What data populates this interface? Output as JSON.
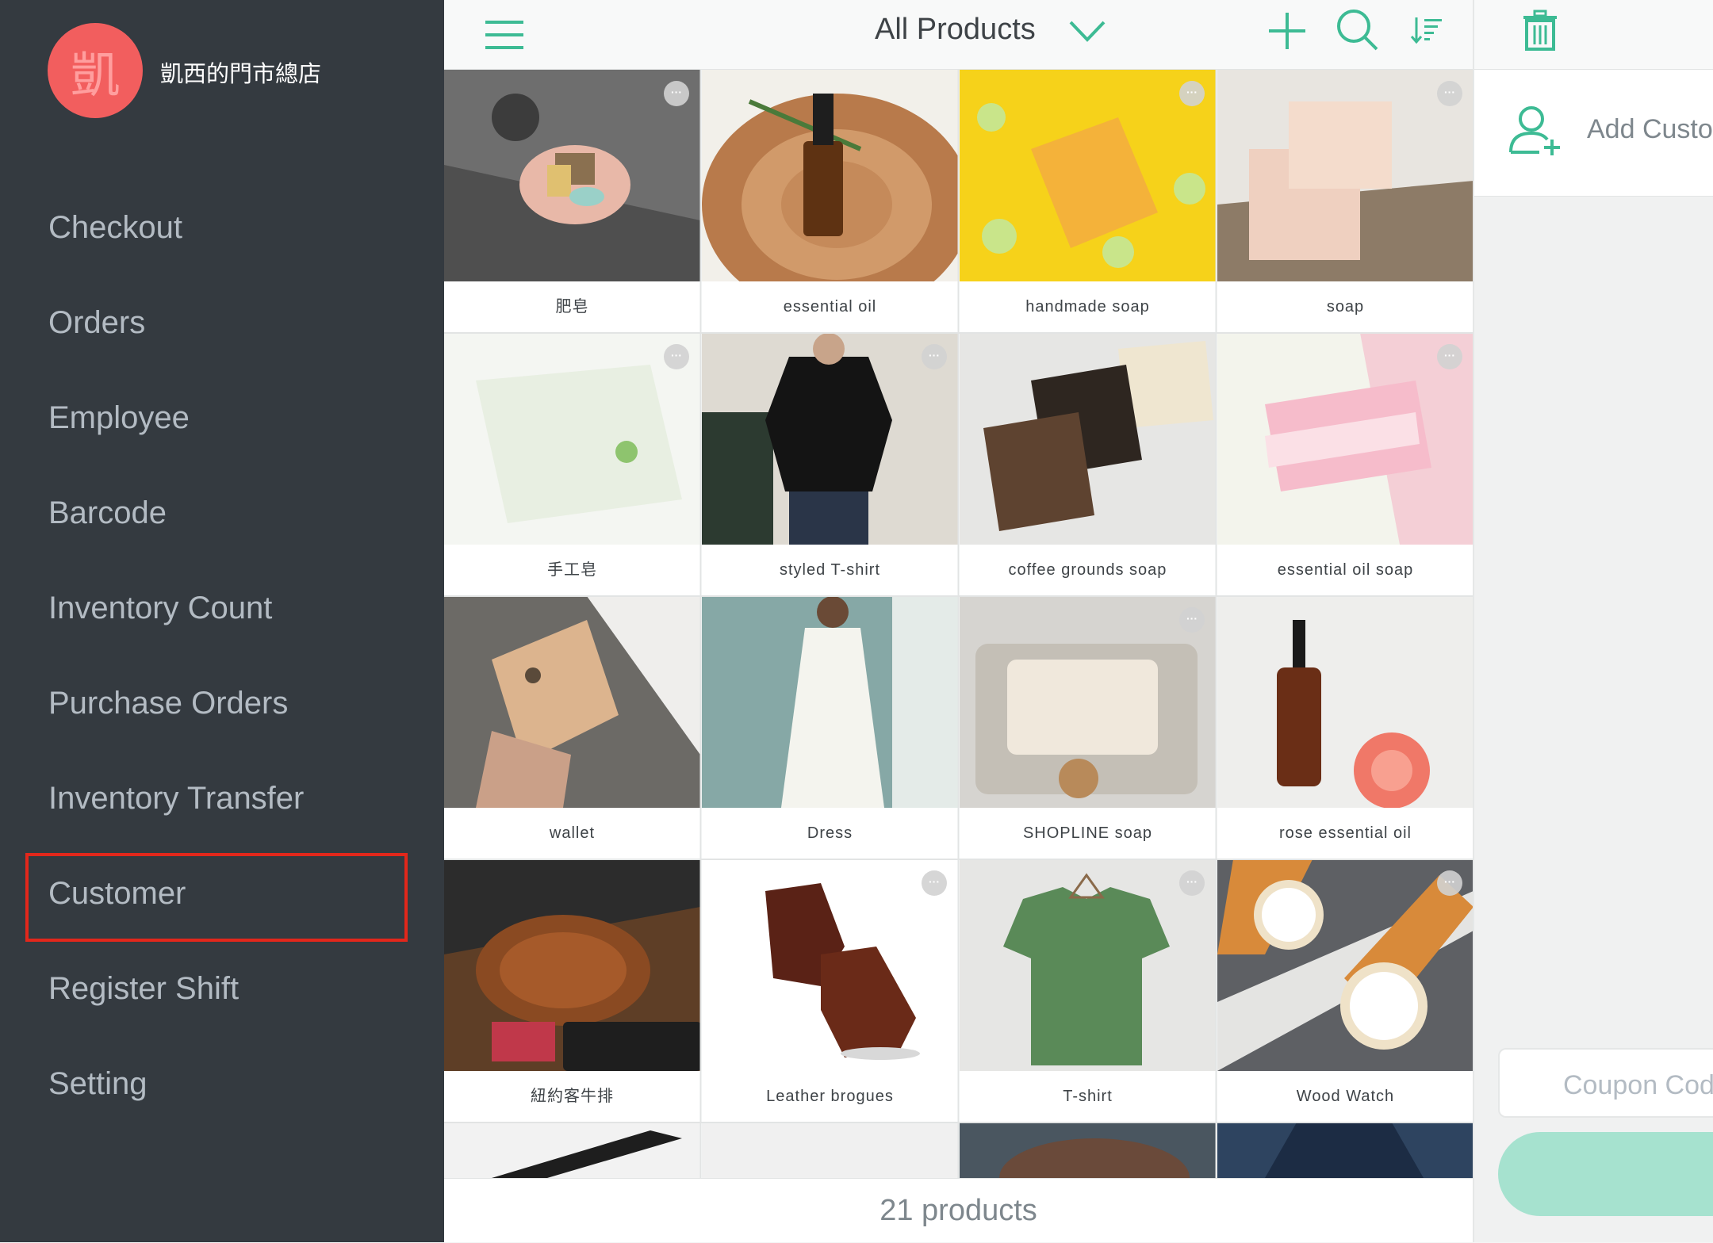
{
  "store": {
    "avatar_char": "凱",
    "name": "凱西的門市總店"
  },
  "nav": {
    "checkout": "Checkout",
    "orders": "Orders",
    "employee": "Employee",
    "barcode": "Barcode",
    "inventory_count": "Inventory Count",
    "purchase_orders": "Purchase Orders",
    "inventory_transfer": "Inventory Transfer",
    "customer": "Customer",
    "register_shift": "Register Shift",
    "setting": "Setting"
  },
  "topbar": {
    "title": "All Products"
  },
  "products": [
    {
      "name": "肥皂"
    },
    {
      "name": "essential oil"
    },
    {
      "name": "handmade soap"
    },
    {
      "name": "soap"
    },
    {
      "name": "手工皂"
    },
    {
      "name": "styled T-shirt"
    },
    {
      "name": "coffee grounds soap"
    },
    {
      "name": "essential oil soap"
    },
    {
      "name": "wallet"
    },
    {
      "name": "Dress"
    },
    {
      "name": "SHOPLINE soap"
    },
    {
      "name": "rose essential oil"
    },
    {
      "name": "紐約客牛排"
    },
    {
      "name": "Leather brogues"
    },
    {
      "name": "T-shirt"
    },
    {
      "name": "Wood Watch"
    }
  ],
  "footer": {
    "count": "21 products"
  },
  "right_panel": {
    "add_customer": "Add Customer",
    "coupon_placeholder": "Coupon Code"
  },
  "colors": {
    "accent": "#3dbb94",
    "sidebar": "#343a40",
    "avatar": "#f25e5e",
    "highlight": "#e2271b"
  }
}
